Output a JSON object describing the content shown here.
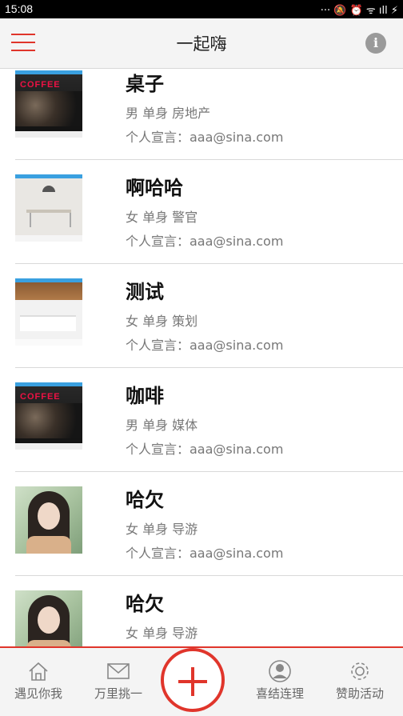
{
  "status_bar": {
    "time": "15:08",
    "icons": "··· 🔕 ⏰ ᯤ ıll ⚡"
  },
  "header": {
    "title": "一起嗨"
  },
  "profiles": [
    {
      "name": "桌子",
      "meta": "男 单身 房地产",
      "motto": "个人宣言：aaa@sina.com",
      "thumb": "cafe-photo"
    },
    {
      "name": "啊哈哈",
      "meta": "女 单身 警官",
      "motto": "个人宣言：aaa@sina.com",
      "thumb": "dining-room-photo"
    },
    {
      "name": "测试",
      "meta": "女 单身 策划",
      "motto": "个人宣言：aaa@sina.com",
      "thumb": "kitchen-photo"
    },
    {
      "name": "咖啡",
      "meta": "男 单身 媒体",
      "motto": "个人宣言：aaa@sina.com",
      "thumb": "cafe-photo"
    },
    {
      "name": "哈欠",
      "meta": "女 单身 导游",
      "motto": "个人宣言：aaa@sina.com",
      "thumb": "person-photo"
    },
    {
      "name": "哈欠",
      "meta": "女 单身 导游",
      "motto": "",
      "thumb": "person-photo"
    }
  ],
  "tabbar": {
    "tabs": [
      {
        "label": "遇见你我",
        "icon": "home-icon"
      },
      {
        "label": "万里挑一",
        "icon": "mail-icon"
      },
      {
        "label": "喜结连理",
        "icon": "user-icon"
      },
      {
        "label": "赞助活动",
        "icon": "gear-icon"
      }
    ],
    "center_button": "add-icon"
  },
  "colors": {
    "accent": "#e0352b",
    "text_muted": "#777777",
    "header_bg": "#f4f4f4"
  }
}
